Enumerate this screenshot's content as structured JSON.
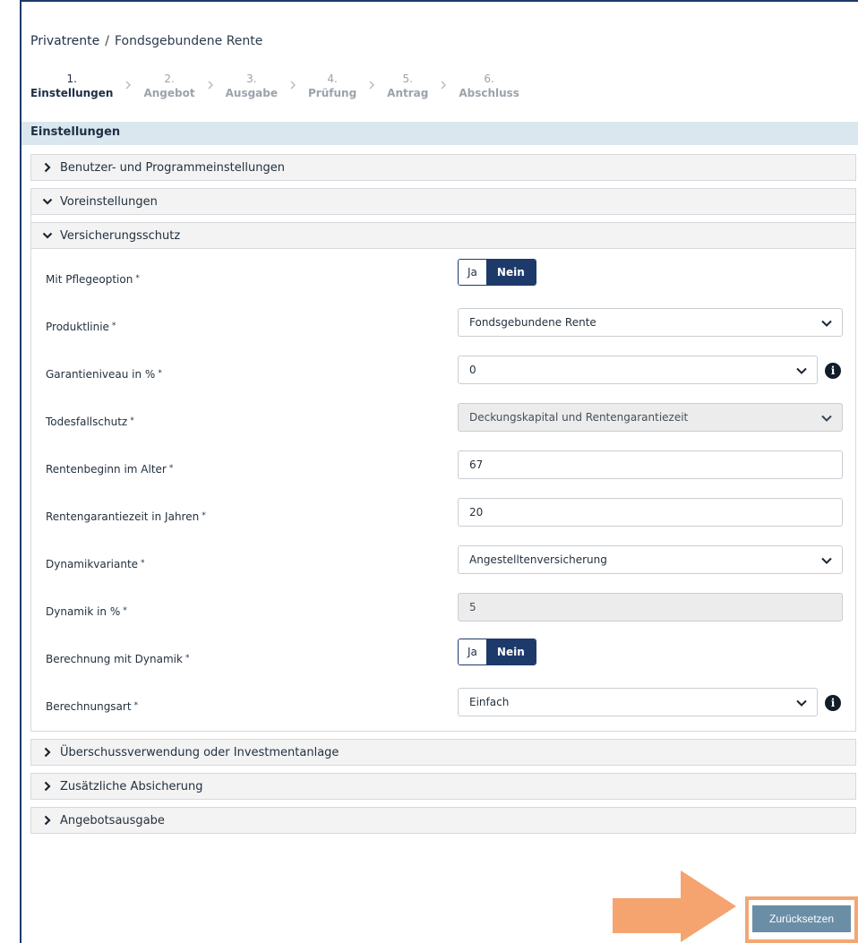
{
  "breadcrumb": {
    "root": "Privatrente",
    "separator": "/",
    "current": "Fondsgebundene Rente"
  },
  "stepper": {
    "steps": [
      {
        "num": "1.",
        "label": "Einstellungen",
        "active": true
      },
      {
        "num": "2.",
        "label": "Angebot",
        "active": false
      },
      {
        "num": "3.",
        "label": "Ausgabe",
        "active": false
      },
      {
        "num": "4.",
        "label": "Prüfung",
        "active": false
      },
      {
        "num": "5.",
        "label": "Antrag",
        "active": false
      },
      {
        "num": "6.",
        "label": "Abschluss",
        "active": false
      }
    ]
  },
  "section": {
    "title": "Einstellungen"
  },
  "accordions": {
    "benutzer": "Benutzer- und Programmeinstellungen",
    "voreinstellungen": "Voreinstellungen",
    "versicherungsschutz": "Versicherungsschutz",
    "ueberschuss": "Überschussverwendung oder Investmentanlage",
    "zusaetzlich": "Zusätzliche Absicherung",
    "angebotsausgabe": "Angebotsausgabe"
  },
  "form": {
    "required_mark": "*",
    "toggle_yes": "Ja",
    "toggle_no": "Nein",
    "pflegeoption": {
      "label": "Mit Pflegeoption"
    },
    "produktlinie": {
      "label": "Produktlinie",
      "value": "Fondsgebundene Rente"
    },
    "garantieniveau": {
      "label": "Garantieniveau in %",
      "value": "0"
    },
    "todesfallschutz": {
      "label": "Todesfallschutz",
      "value": "Deckungskapital und Rentengarantiezeit"
    },
    "rentenbeginn": {
      "label": "Rentenbeginn im Alter",
      "value": "67"
    },
    "rentengarantiezeit": {
      "label": "Rentengarantiezeit in Jahren",
      "value": "20"
    },
    "dynamikvariante": {
      "label": "Dynamikvariante",
      "value": "Angestelltenversicherung"
    },
    "dynamik": {
      "label": "Dynamik in %",
      "value": "5"
    },
    "berechnung_dynamik": {
      "label": "Berechnung mit Dynamik"
    },
    "berechnungsart": {
      "label": "Berechnungsart",
      "value": "Einfach"
    },
    "info_glyph": "i"
  },
  "actions": {
    "reset_label": "Zurücksetzen"
  },
  "colors": {
    "primary": "#1d3a6b",
    "section_bg": "#dbe7ef",
    "accordion_bg": "#f3f3f3",
    "reset_bg": "#6a8ea6",
    "highlight": "#f3a773"
  }
}
